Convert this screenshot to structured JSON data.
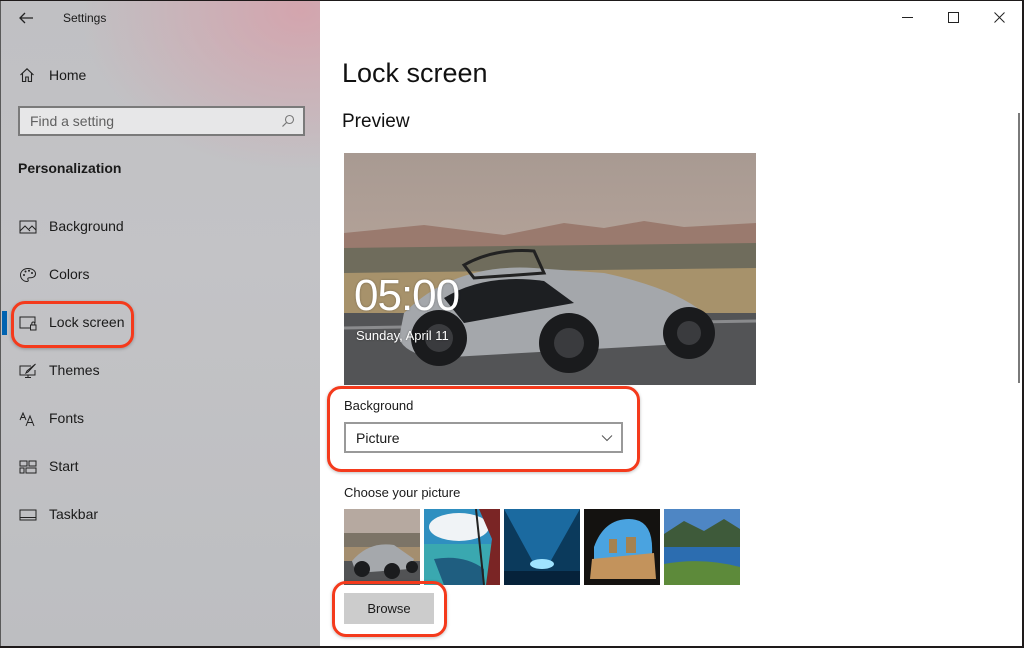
{
  "window": {
    "app_title": "Settings",
    "caption_buttons": [
      "minimize",
      "maximize",
      "close"
    ]
  },
  "sidebar": {
    "home_label": "Home",
    "search": {
      "placeholder": "Find a setting",
      "value": ""
    },
    "section_title": "Personalization",
    "items": [
      {
        "label": "Background",
        "icon": "picture-icon",
        "selected": false
      },
      {
        "label": "Colors",
        "icon": "palette-icon",
        "selected": false
      },
      {
        "label": "Lock screen",
        "icon": "lock-screen-icon",
        "selected": true
      },
      {
        "label": "Themes",
        "icon": "themes-icon",
        "selected": false
      },
      {
        "label": "Fonts",
        "icon": "fonts-icon",
        "selected": false
      },
      {
        "label": "Start",
        "icon": "start-icon",
        "selected": false
      },
      {
        "label": "Taskbar",
        "icon": "taskbar-icon",
        "selected": false
      }
    ]
  },
  "main": {
    "page_title": "Lock screen",
    "preview_title": "Preview",
    "preview": {
      "time": "05:00",
      "date": "Sunday, April 11"
    },
    "background_label": "Background",
    "background_value": "Picture",
    "choose_label": "Choose your picture",
    "thumbnails": [
      "Sports car on road",
      "Sea view from aircraft window",
      "Blue ice cave",
      "Beach cave with rocks",
      "Mountain lake reflection"
    ],
    "browse_label": "Browse"
  },
  "annotations": {
    "color": "#f43a1c",
    "highlighted": [
      "Lock screen nav item",
      "Background dropdown",
      "Browse button"
    ]
  }
}
